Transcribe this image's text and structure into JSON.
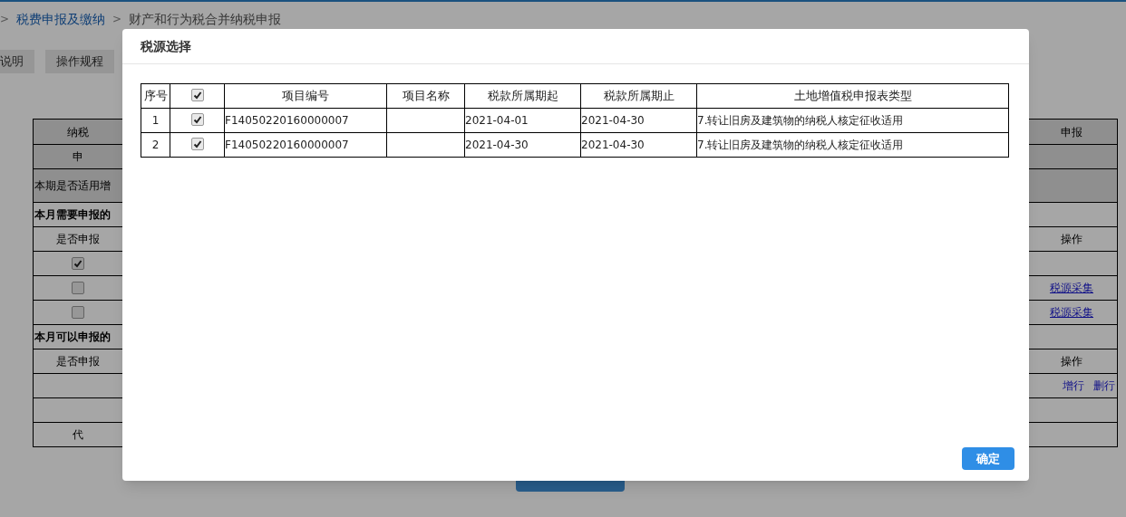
{
  "breadcrumb": [
    {
      "prefix": ">",
      "label": "税费申报及缴纳",
      "kind": "link"
    },
    {
      "prefix": ">",
      "label": "财产和行为税合并纳税申报",
      "kind": "current"
    }
  ],
  "toolbar": [
    "说明",
    "操作规程"
  ],
  "background_table": {
    "rows": [
      {
        "kind": "header",
        "left": "纳税",
        "right": "申报"
      },
      {
        "kind": "header",
        "left": "申"
      },
      {
        "kind": "tall",
        "left": "本期是否适用增"
      },
      {
        "kind": "section",
        "left": "本月需要申报的"
      },
      {
        "kind": "plain",
        "left": "是否申报",
        "right": "操作"
      },
      {
        "kind": "checkbox",
        "checked": true
      },
      {
        "kind": "checkbox",
        "checked": false,
        "links": [
          "税源采集"
        ]
      },
      {
        "kind": "checkbox",
        "checked": false,
        "links": [
          "税源采集"
        ]
      },
      {
        "kind": "section",
        "left": "本月可以申报的"
      },
      {
        "kind": "plain",
        "left": "是否申报",
        "right": "操作"
      },
      {
        "kind": "plain",
        "links": [
          "增行",
          "删行"
        ]
      },
      {
        "kind": "plain"
      },
      {
        "kind": "plain",
        "left": "代"
      }
    ]
  },
  "dialog": {
    "title": "税源选择",
    "table": {
      "columns": [
        "序号",
        "项目编号",
        "项目名称",
        "税款所属期起",
        "税款所属期止",
        "土地增值税申报表类型"
      ],
      "select_all_checked": true,
      "rows": [
        {
          "index": "1",
          "checked": true,
          "code": "F14050220160000007",
          "start": "2021-04-01",
          "end": "2021-04-30",
          "type": "7.转让旧房及建筑物的纳税人核定征收适用"
        },
        {
          "index": "2",
          "checked": true,
          "code": "F14050220160000007",
          "start": "2021-04-30",
          "end": "2021-04-30",
          "type": "7.转让旧房及建筑物的纳税人核定征收适用"
        }
      ]
    },
    "confirm_button": "确定"
  }
}
